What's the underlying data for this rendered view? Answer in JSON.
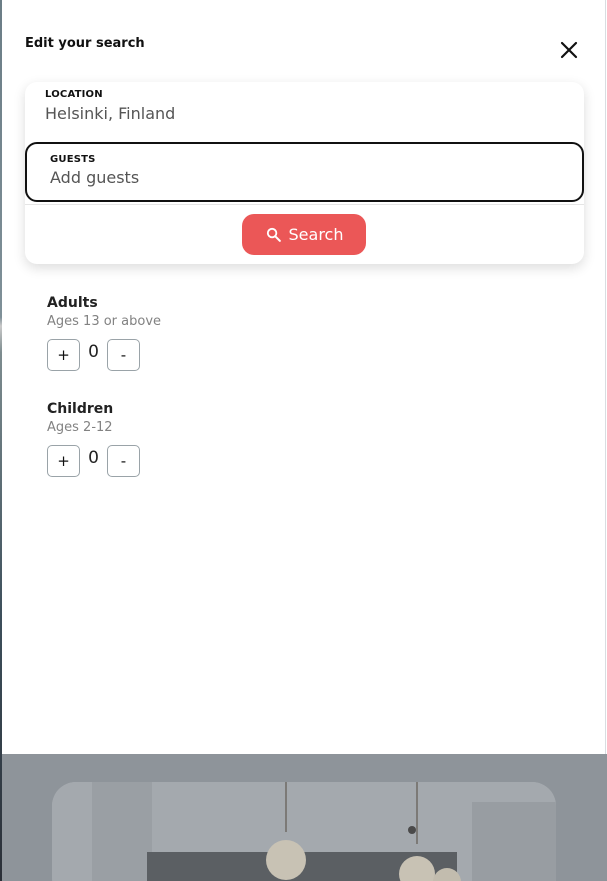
{
  "drawer": {
    "title": "Edit your search"
  },
  "search_card": {
    "location_label": "LOCATION",
    "location_value": "Helsinki, Finland",
    "guests_label": "GUESTS",
    "guests_placeholder": "Add guests",
    "search_button_label": "Search"
  },
  "guests": {
    "adults": {
      "title": "Adults",
      "subtitle": "Ages 13 or above",
      "count": "0",
      "plus_label": "+",
      "minus_label": "-"
    },
    "children": {
      "title": "Children",
      "subtitle": "Ages 2-12",
      "count": "0",
      "plus_label": "+",
      "minus_label": "-"
    }
  },
  "icons": {
    "close": "close-icon",
    "search": "search-icon"
  },
  "colors": {
    "accent": "#eb5757",
    "overlay": "#8e949a"
  }
}
